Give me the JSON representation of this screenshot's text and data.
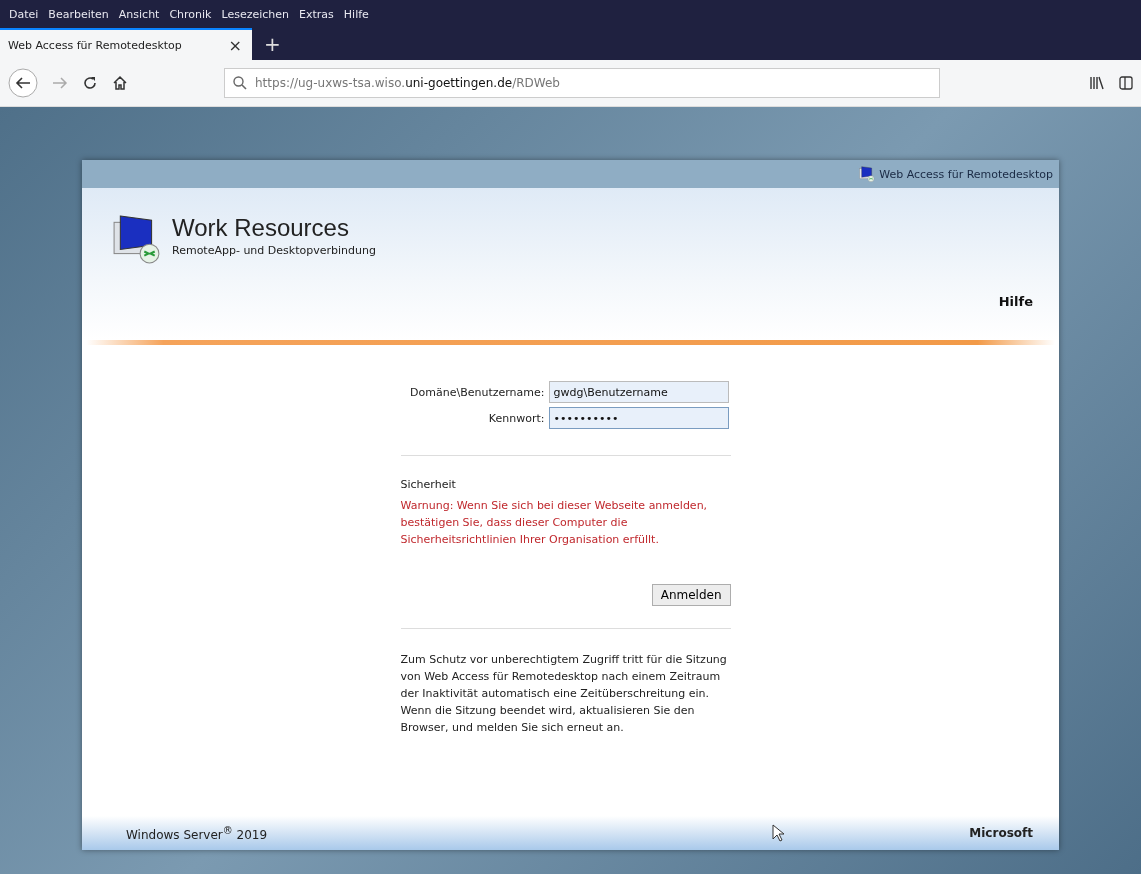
{
  "menu": [
    "Datei",
    "Bearbeiten",
    "Ansicht",
    "Chronik",
    "Lesezeichen",
    "Extras",
    "Hilfe"
  ],
  "tabs": [
    {
      "label": "Web Access für Remotedesktop",
      "selected": true,
      "close": "×"
    }
  ],
  "new_tab": "+",
  "address": {
    "prefix": "https://ug-uxws-tsa.wiso.",
    "domain": "uni-goettingen.de",
    "suffix": "/RDWeb"
  },
  "page": {
    "top_link": "Web Access für Remotedesktop",
    "title": "Work Resources",
    "subtitle": "RemoteApp- und Desktopverbindung",
    "help": "Hilfe",
    "fields": [
      {
        "label": "Domäne\\Benutzername:",
        "value": "gwdg\\Benutzername",
        "focused": false
      },
      {
        "label": "Kennwort:",
        "value": "••••••••••",
        "focused": true
      }
    ],
    "security_heading": "Sicherheit",
    "warning": "Warnung: Wenn Sie sich bei dieser Webseite anmelden, bestätigen Sie, dass dieser Computer die Sicherheitsrichtlinien Ihrer Organisation erfüllt.",
    "submit": "Anmelden",
    "notice": "Zum Schutz vor unberechtigtem Zugriff tritt für die Sitzung von Web Access für Remotedesktop nach einem Zeitraum der Inaktivität automatisch eine Zeitüberschreitung ein. Wenn die Sitzung beendet wird, aktualisieren Sie den Browser, und melden Sie sich erneut an.",
    "footer_left": "Windows Server$^{®}$ 2019",
    "footer_right": "Microsoft"
  }
}
